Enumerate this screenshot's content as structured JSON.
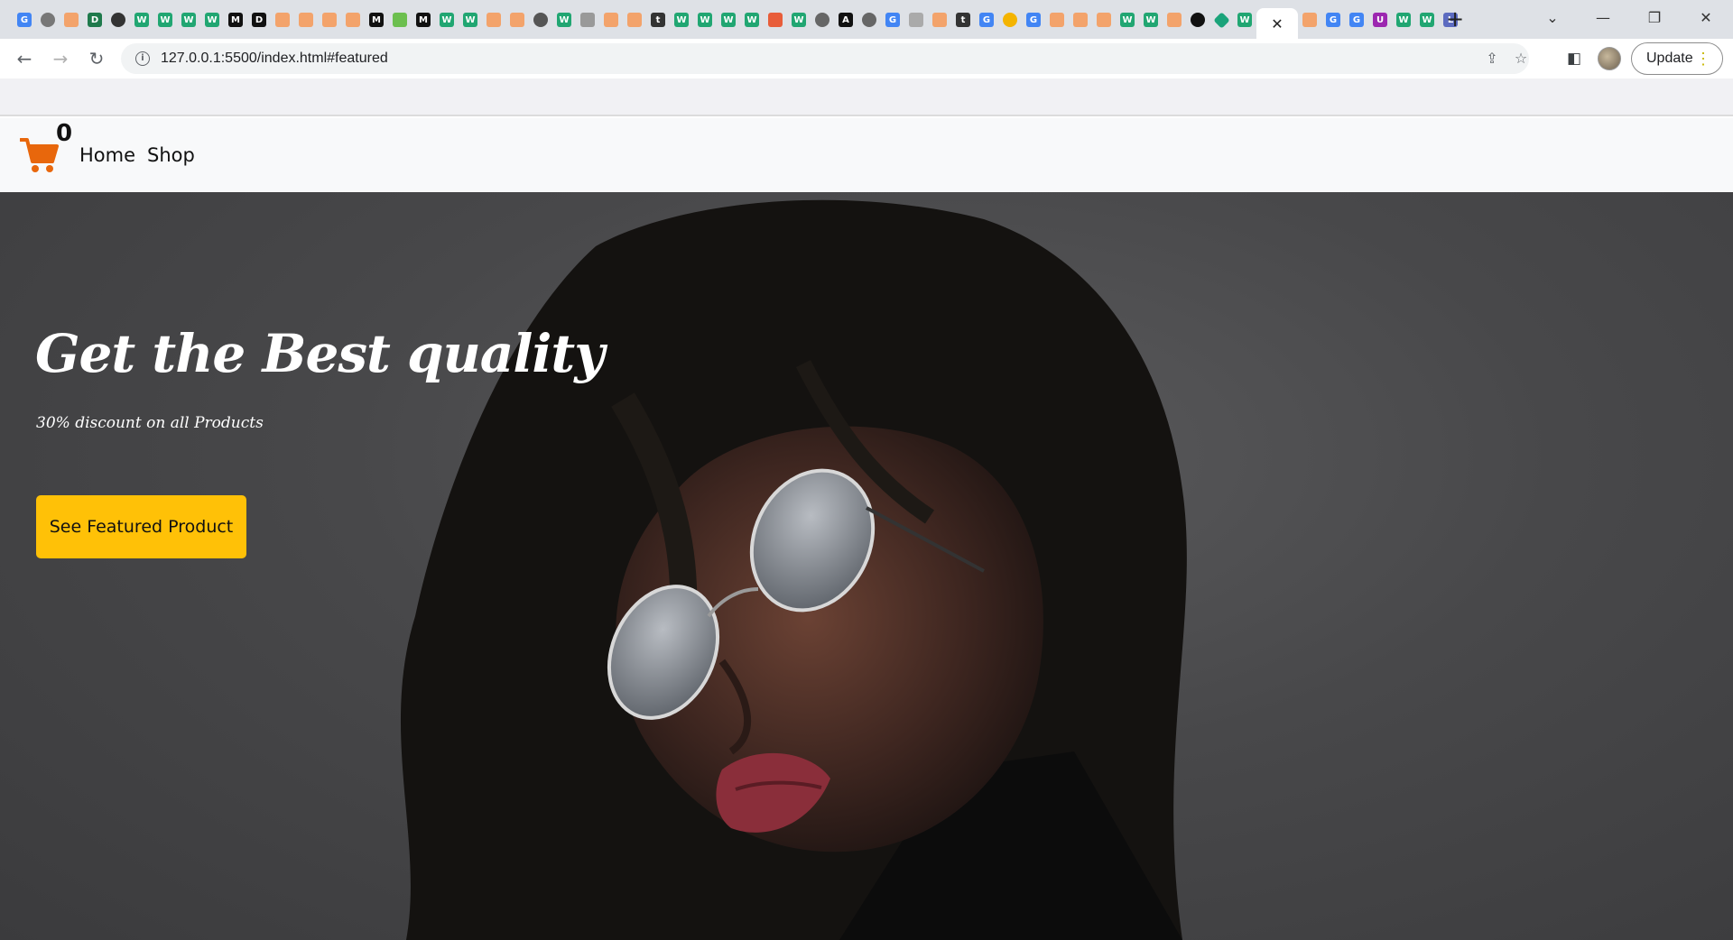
{
  "browser": {
    "url": "127.0.0.1:5500/index.html#featured",
    "update_label": "Update",
    "tab_close": "✕",
    "new_tab": "+"
  },
  "site": {
    "cart_count": "0",
    "nav": {
      "home": "Home",
      "shop": "Shop"
    },
    "hero": {
      "title": "Get the Best quality",
      "subtitle": "30% discount on all Products",
      "button_label": "See Featured Product"
    }
  },
  "colors": {
    "accent": "#ffc107",
    "cart": "#e8670c",
    "nav_background": "#f8f9fa",
    "hero_background": "#48484a"
  }
}
